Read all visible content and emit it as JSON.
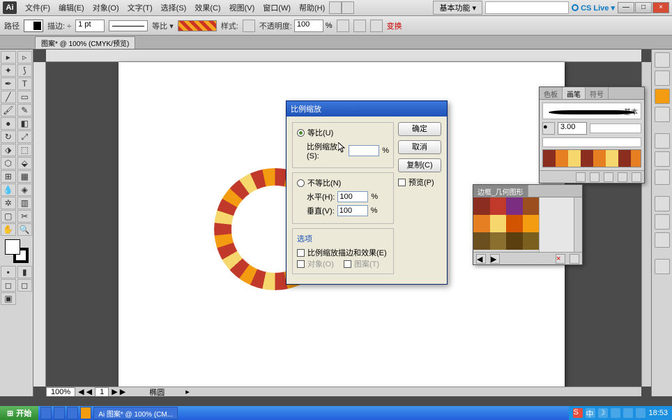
{
  "menubar": {
    "logo": "Ai",
    "items": [
      "文件(F)",
      "编辑(E)",
      "对象(O)",
      "文字(T)",
      "选择(S)",
      "效果(C)",
      "视图(V)",
      "窗口(W)",
      "帮助(H)"
    ],
    "essentials": "基本功能 ▾",
    "cslive": "CS Live ▾"
  },
  "controlbar": {
    "label1": "路径",
    "stroke_label": "描边: ÷",
    "stroke_val": "1 pt",
    "uniform": "等比 ▾",
    "style": "样式:",
    "opacity_label": "不透明度:",
    "opacity_val": "100",
    "pct": "%",
    "transform": "变换"
  },
  "doctab": "图案* @ 100% (CMYK/预览)",
  "dialog": {
    "title": "比例缩放",
    "uniform": "等比(U)",
    "scale_label": "比例缩放(S):",
    "scale_val": "",
    "pct": "%",
    "nonuniform": "不等比(N)",
    "horiz": "水平(H):",
    "horiz_val": "100",
    "vert": "垂直(V):",
    "vert_val": "100",
    "options": "选项",
    "scale_strokes": "比例缩放描边和效果(E)",
    "objects": "对象(O)",
    "patterns": "图案(T)",
    "ok": "确定",
    "cancel": "取消",
    "copy": "复制(C)",
    "preview": "预览(P)"
  },
  "brush_panel": {
    "tabs": [
      "色板",
      "画笔",
      "符号"
    ],
    "basic": "基本",
    "weight": "3.00"
  },
  "geom_panel": {
    "title": "边框_几何图形"
  },
  "statusbar": {
    "zoom": "100%",
    "artboard_nav": "1",
    "tool": "椭圆"
  },
  "taskbar": {
    "start": "开始",
    "task": "Ai 图案* @ 100% (CM...",
    "time": "18:53"
  }
}
